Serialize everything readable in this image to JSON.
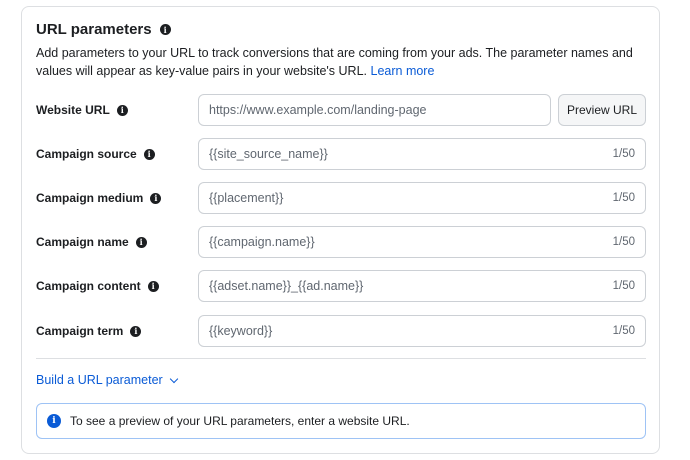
{
  "section": {
    "title": "URL parameters",
    "description": "Add parameters to your URL to track conversions that are coming from your ads. The parameter names and values will appear as key-value pairs in your website's URL.",
    "learn_more": "Learn more"
  },
  "website_url": {
    "label": "Website URL",
    "placeholder": "https://www.example.com/landing-page",
    "preview_button": "Preview URL"
  },
  "params": [
    {
      "label": "Campaign source",
      "value": "{{site_source_name}}",
      "count": "1/50"
    },
    {
      "label": "Campaign medium",
      "value": "{{placement}}",
      "count": "1/50"
    },
    {
      "label": "Campaign name",
      "value": "{{campaign.name}}",
      "count": "1/50"
    },
    {
      "label": "Campaign content",
      "value": "{{adset.name}}_{{ad.name}}",
      "count": "1/50"
    },
    {
      "label": "Campaign term",
      "value": "{{keyword}}",
      "count": "1/50"
    }
  ],
  "build": {
    "label": "Build a URL parameter"
  },
  "notice": {
    "text": "To see a preview of your URL parameters, enter a website URL."
  },
  "icons": {
    "info": "info-icon",
    "chevron": "chevron-down-icon",
    "notice": "info-circle-icon"
  },
  "colors": {
    "link": "#0a5bd6",
    "border": "#ccd0d5",
    "notice_border": "#9ec3f5"
  }
}
